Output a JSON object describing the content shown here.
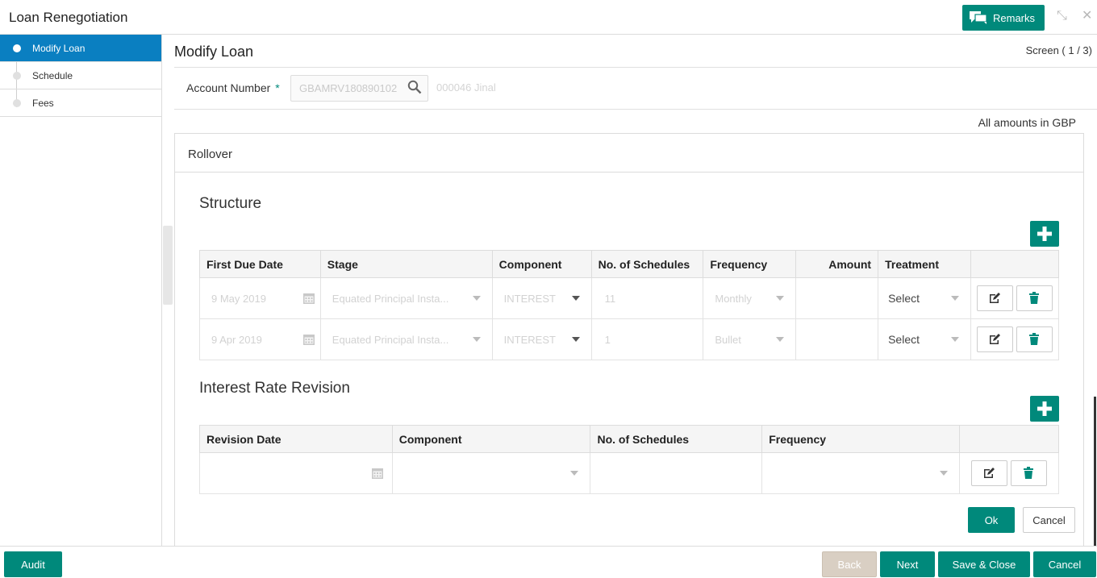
{
  "header": {
    "title": "Loan Renegotiation",
    "remarks_label": "Remarks"
  },
  "sidebar": {
    "items": [
      {
        "label": "Modify Loan",
        "active": true
      },
      {
        "label": "Schedule",
        "active": false
      },
      {
        "label": "Fees",
        "active": false
      }
    ]
  },
  "main": {
    "title": "Modify Loan",
    "screen_indicator": "Screen ( 1 / 3)",
    "account_label": "Account Number",
    "required_mark": "*",
    "account_value": "GBAMRV180890102",
    "account_name": "000046 Jinal",
    "amounts_note": "All amounts in GBP",
    "panel_title": "Rollover"
  },
  "structure": {
    "title": "Structure",
    "headers": [
      "First Due Date",
      "Stage",
      "Component",
      "No. of Schedules",
      "Frequency",
      "Amount",
      "Treatment",
      ""
    ],
    "rows": [
      {
        "due_date": "9 May 2019",
        "stage": "Equated Principal Insta...",
        "component": "INTEREST",
        "schedules": "11",
        "frequency": "Monthly",
        "amount": "",
        "treatment": "Select"
      },
      {
        "due_date": "9 Apr 2019",
        "stage": "Equated Principal Insta...",
        "component": "INTEREST",
        "schedules": "1",
        "frequency": "Bullet",
        "amount": "",
        "treatment": "Select"
      }
    ]
  },
  "interest": {
    "title": "Interest Rate Revision",
    "headers": [
      "Revision Date",
      "Component",
      "No. of Schedules",
      "Frequency",
      ""
    ]
  },
  "buttons": {
    "ok": "Ok",
    "cancel_small": "Cancel",
    "audit": "Audit",
    "back": "Back",
    "next": "Next",
    "save_close": "Save & Close",
    "cancel": "Cancel"
  },
  "colors": {
    "accent": "#00897b",
    "sidebar_active": "#0a7fc1"
  }
}
